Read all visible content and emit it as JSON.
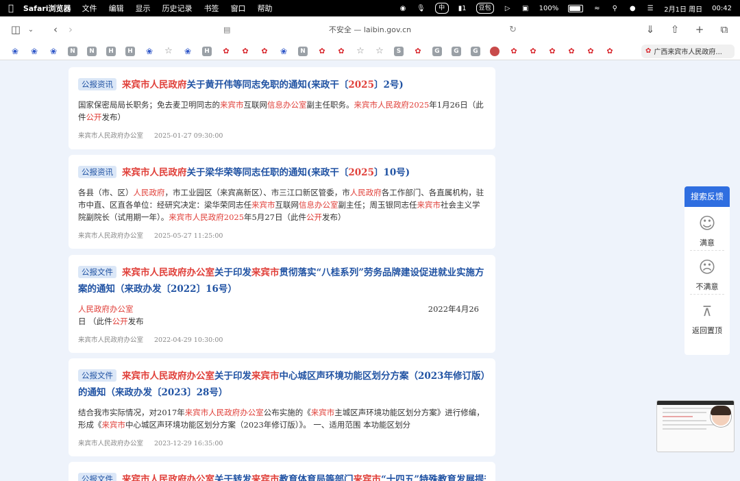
{
  "menubar": {
    "app_name": "Safari浏览器",
    "menus": [
      "文件",
      "编辑",
      "显示",
      "历史记录",
      "书签",
      "窗口",
      "帮助"
    ],
    "tray": {
      "input_method": "中",
      "badge_one": "1",
      "doubao": "豆包",
      "battery_percent": "100%",
      "date": "2月1日 周日",
      "time": "00:42"
    }
  },
  "toolbar": {
    "url_text": "不安全 — laibin.gov.cn"
  },
  "favorites": {
    "items": [
      "paw",
      "paw",
      "paw",
      "N",
      "N",
      "H",
      "H",
      "paw",
      "star",
      "paw",
      "H",
      "emb",
      "emb",
      "emb",
      "paw",
      "N",
      "emb",
      "emb",
      "star",
      "star",
      "S",
      "emb",
      "G",
      "G",
      "G",
      "ball",
      "emb",
      "emb",
      "emb",
      "emb",
      "emb",
      "emb"
    ],
    "active_tab": "广西来宾市人民政府..."
  },
  "cards": [
    {
      "tag": "公报资讯",
      "title_red": "来宾市人民政府",
      "title_rest": "关于黄开伟等同志免职的通知(来政干〔",
      "title_num": "2025",
      "title_end": "〕2号)",
      "body_segments": [
        {
          "t": "国家保密局局长职务；免去麦卫明同志的",
          "red": false
        },
        {
          "t": "来宾市",
          "red": true
        },
        {
          "t": "互联网",
          "red": false
        },
        {
          "t": "信息办公室",
          "red": true
        },
        {
          "t": "副主任职务。",
          "red": false
        },
        {
          "t": "来宾市人民政府2025",
          "red": true
        },
        {
          "t": "年1月26日（此件",
          "red": false
        },
        {
          "t": "公开",
          "red": true
        },
        {
          "t": "发布）",
          "red": false
        }
      ],
      "source": "来宾市人民政府办公室",
      "datetime": "2025-01-27 09:30:00"
    },
    {
      "tag": "公报资讯",
      "title_red": "来宾市人民政府",
      "title_rest": "关于梁华荣等同志任职的通知(来政干〔",
      "title_num": "2025",
      "title_end": "〕10号)",
      "body_segments": [
        {
          "t": "各县（市、区）",
          "red": false
        },
        {
          "t": "人民政府",
          "red": true
        },
        {
          "t": "，市工业园区（来宾高新区）、市三江口新区管委，市",
          "red": false
        },
        {
          "t": "人民政府",
          "red": true
        },
        {
          "t": "各工作部门、各直属机构，驻市中直、区直各单位：经研究决定：梁华荣同志任",
          "red": false
        },
        {
          "t": "来宾市",
          "red": true
        },
        {
          "t": "互联网",
          "red": false
        },
        {
          "t": "信息办公室",
          "red": true
        },
        {
          "t": "副主任；周玉银同志任",
          "red": false
        },
        {
          "t": "来宾市",
          "red": true
        },
        {
          "t": "社会主义学院副院长（试用期一年）。",
          "red": false
        },
        {
          "t": "来宾市人民政府2025",
          "red": true
        },
        {
          "t": "年5月27日（此件",
          "red": false
        },
        {
          "t": "公开",
          "red": true
        },
        {
          "t": "发布）",
          "red": false
        }
      ],
      "source": "来宾市人民政府办公室",
      "datetime": "2025-05-27 11:25:00"
    },
    {
      "tag": "公报文件",
      "title_segments": [
        {
          "t": "来宾市人民政府办公室",
          "red": true
        },
        {
          "t": "关于印发",
          "red": false
        },
        {
          "t": "来宾市",
          "red": true
        },
        {
          "t": "贯彻落实“八桂系列”劳务品牌建设促进就业实施方案的通知（来政办发〔2022〕16号）",
          "red": false
        }
      ],
      "body_red": "人民政府办公室",
      "body_date": "2022年4月26",
      "body_line2_a": "日 （此件",
      "body_line2_red": "公开",
      "body_line2_b": "发布",
      "source": "来宾市人民政府办公室",
      "datetime": "2022-04-29 10:30:00"
    },
    {
      "tag": "公报文件",
      "title_segments": [
        {
          "t": "来宾市人民政府办公室",
          "red": true
        },
        {
          "t": "关于印发",
          "red": false
        },
        {
          "t": "来宾市",
          "red": true
        },
        {
          "t": "中心城区声环境功能区划分方案（2023年修订版）的通知（来政办发〔2023〕28号）",
          "red": false
        }
      ],
      "body_segments": [
        {
          "t": "结合我市实际情况，对2017年",
          "red": false
        },
        {
          "t": "来宾市人民政府办公室",
          "red": true
        },
        {
          "t": "公布实施的《",
          "red": false
        },
        {
          "t": "来宾市",
          "red": true
        },
        {
          "t": "主城区声环境功能区划分方案》进行修编，形成《",
          "red": false
        },
        {
          "t": "来宾市",
          "red": true
        },
        {
          "t": "中心城区声环境功能区划分方案（2023年修订版）》。 一、适用范围 本功能区划分",
          "red": false
        }
      ],
      "source": "来宾市人民政府办公室",
      "datetime": "2023-12-29 16:35:00"
    },
    {
      "tag": "公报文件",
      "title_segments": [
        {
          "t": "来宾市人民政府办公室",
          "red": true
        },
        {
          "t": "关于转发",
          "red": false
        },
        {
          "t": "来宾市",
          "red": true
        },
        {
          "t": "教育体育局等部门",
          "red": false
        },
        {
          "t": "来宾市",
          "red": true
        },
        {
          "t": "“十四五”特殊教育发展提升",
          "red": false
        }
      ]
    }
  ],
  "feedback": {
    "header": "搜索反馈",
    "satisfied": "满意",
    "unsatisfied": "不满意",
    "back_to_top": "返回置顶"
  },
  "colors": {
    "link_blue": "#2153a3",
    "highlight_red": "#e0403a",
    "feedback_blue": "#2f6ee0",
    "page_bg": "#eef3fb"
  }
}
